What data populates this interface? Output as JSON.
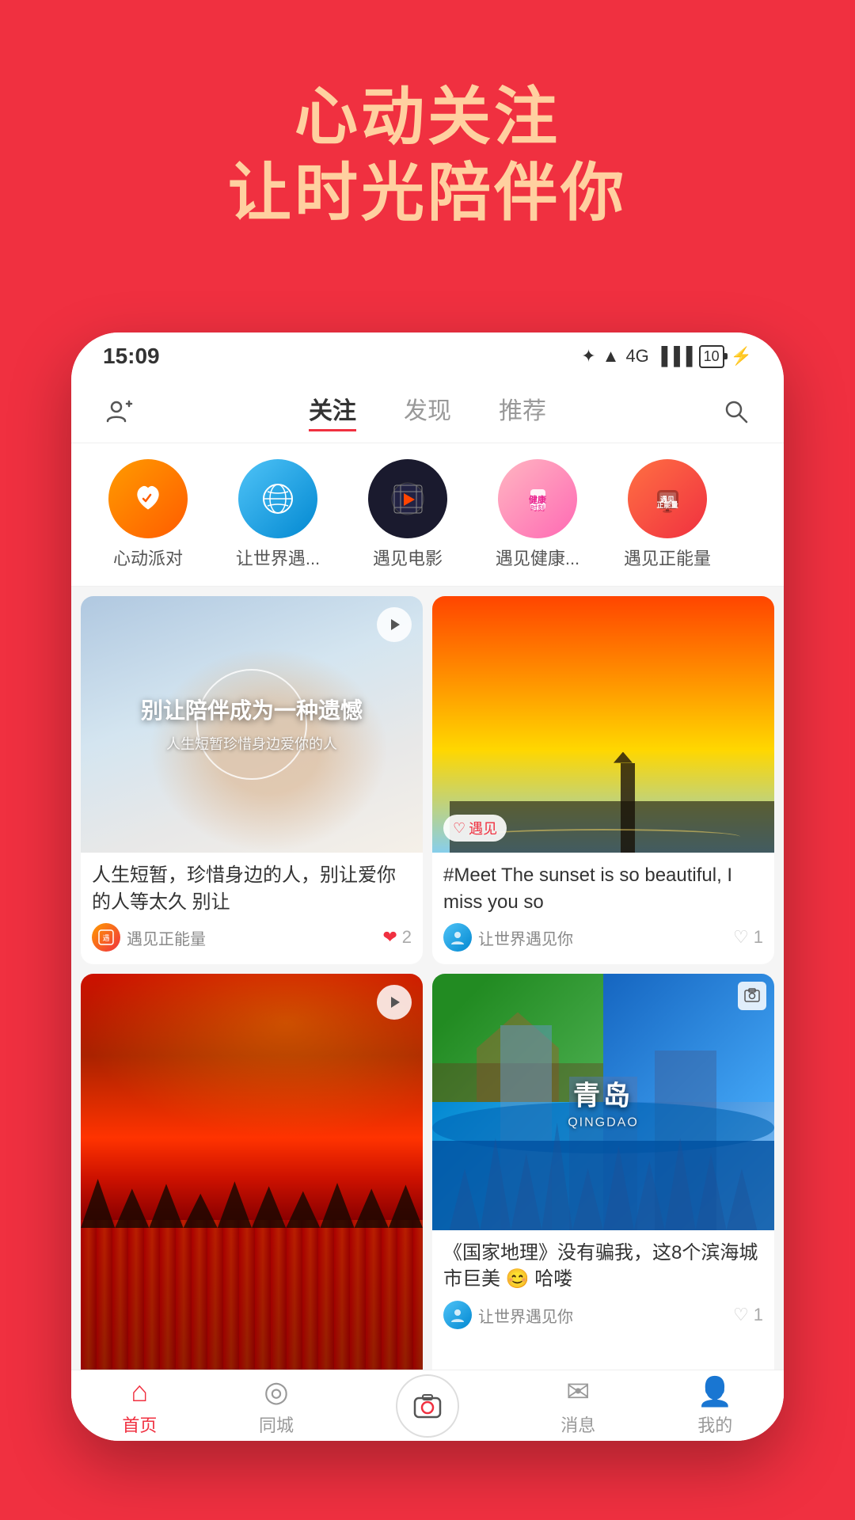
{
  "app": {
    "background_color": "#F03040",
    "header": {
      "line1": "心动关注",
      "line2": "让时光陪伴你"
    }
  },
  "phone": {
    "status_bar": {
      "time": "15:09",
      "battery_level": "10"
    },
    "nav": {
      "add_friend_icon": "👤+",
      "tabs": [
        {
          "label": "关注",
          "active": true
        },
        {
          "label": "发现",
          "active": false
        },
        {
          "label": "推荐",
          "active": false
        }
      ],
      "search_icon": "🔍"
    },
    "channels": [
      {
        "label": "心动派对",
        "color": "ch1"
      },
      {
        "label": "让世界遇...",
        "color": "ch2"
      },
      {
        "label": "遇见电影",
        "color": "ch3"
      },
      {
        "label": "遇见健康...",
        "color": "ch4"
      },
      {
        "label": "遇见正能量",
        "color": "ch5"
      }
    ],
    "cards": [
      {
        "id": "card1",
        "type": "video",
        "overlay_text": "别让陪伴成为一种遗憾",
        "overlay_sub": "人生短暂珍惜身边爱你的人",
        "title": "人生短暂，珍惜身边的人，别让爱你的人等太久 别让",
        "author": "遇见正能量",
        "likes": "2",
        "liked": true
      },
      {
        "id": "card2",
        "type": "image",
        "hashtag": "#Meet The sunset is so beautiful, I miss you so",
        "author": "让世界遇见你",
        "likes": "1",
        "liked": false
      },
      {
        "id": "card3",
        "type": "video",
        "title": "",
        "author": "",
        "likes": "",
        "liked": false
      },
      {
        "id": "card4",
        "type": "image",
        "city_name": "青岛",
        "city_pinyin": "QINGDAO",
        "title": "《国家地理》没有骗我，这8个滨海城市巨美 😊 哈喽",
        "author": "让世界遇见你",
        "likes": "1",
        "liked": false
      }
    ],
    "bottom_nav": [
      {
        "label": "首页",
        "active": true
      },
      {
        "label": "同城",
        "active": false
      },
      {
        "label": "camera",
        "active": false
      },
      {
        "label": "消息",
        "active": false
      },
      {
        "label": "我的",
        "active": false
      }
    ]
  }
}
